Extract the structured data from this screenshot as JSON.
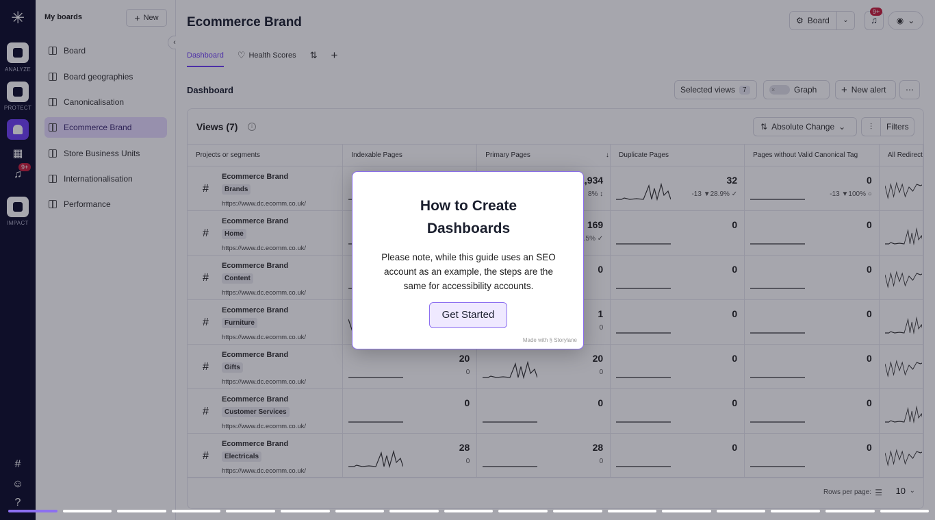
{
  "rail": {
    "sections": [
      "ANALYZE",
      "PROTECT",
      "IMPACT"
    ],
    "notif_badge": "9+"
  },
  "sidebar": {
    "title": "My boards",
    "new_label": "New",
    "items": [
      {
        "label": "Board"
      },
      {
        "label": "Board geographies"
      },
      {
        "label": "Canonicalisation"
      },
      {
        "label": "Ecommerce Brand"
      },
      {
        "label": "Store Business Units"
      },
      {
        "label": "Internationalisation"
      },
      {
        "label": "Performance"
      }
    ]
  },
  "header": {
    "title": "Ecommerce Brand",
    "board_label": "Board",
    "bell_badge": "9+"
  },
  "tabs": [
    {
      "label": "Dashboard"
    },
    {
      "label": "Health Scores"
    }
  ],
  "toolbar": {
    "title": "Dashboard",
    "selected_views": "Selected views",
    "selected_count": "7",
    "graph": "Graph",
    "new_alert": "New alert"
  },
  "views": {
    "title": "Views (7)",
    "sort_label": "Absolute Change",
    "filters_label": "Filters"
  },
  "table": {
    "columns": [
      "Projects or segments",
      "Indexable Pages",
      "Primary Pages",
      "Duplicate Pages",
      "Pages without Valid Canonical Tag",
      "All Redirect"
    ],
    "rows": [
      {
        "name": "Ecommerce Brand",
        "tag": "Brands",
        "url": "https://www.dc.ecomm.co.uk/",
        "indexable": "",
        "primary": "1,934",
        "primary_delta": "8% ↕",
        "duplicate": "32",
        "duplicate_delta": "-13 ▼28.9% ✓",
        "canonical": "0",
        "canonical_delta": "-13 ▼100% ○"
      },
      {
        "name": "Ecommerce Brand",
        "tag": "Home",
        "url": "https://www.dc.ecomm.co.uk/",
        "indexable": "",
        "primary": "169",
        "primary_delta": ".5% ✓",
        "duplicate": "0",
        "duplicate_delta": "",
        "canonical": "0",
        "canonical_delta": ""
      },
      {
        "name": "Ecommerce Brand",
        "tag": "Content",
        "url": "https://www.dc.ecomm.co.uk/",
        "indexable": "",
        "primary": "0",
        "primary_delta": "",
        "duplicate": "0",
        "duplicate_delta": "",
        "canonical": "0",
        "canonical_delta": ""
      },
      {
        "name": "Ecommerce Brand",
        "tag": "Furniture",
        "url": "https://www.dc.ecomm.co.uk/",
        "indexable": "",
        "primary": "1",
        "primary_delta": "0",
        "duplicate": "0",
        "duplicate_delta": "",
        "canonical": "0",
        "canonical_delta": ""
      },
      {
        "name": "Ecommerce Brand",
        "tag": "Gifts",
        "url": "https://www.dc.ecomm.co.uk/",
        "indexable": "20",
        "indexable_delta": "0",
        "primary": "20",
        "primary_delta": "0",
        "duplicate": "0",
        "duplicate_delta": "",
        "canonical": "0",
        "canonical_delta": ""
      },
      {
        "name": "Ecommerce Brand",
        "tag": "Customer Services",
        "url": "https://www.dc.ecomm.co.uk/",
        "indexable": "0",
        "indexable_delta": "",
        "primary": "0",
        "primary_delta": "",
        "duplicate": "0",
        "duplicate_delta": "",
        "canonical": "0",
        "canonical_delta": ""
      },
      {
        "name": "Ecommerce Brand",
        "tag": "Electricals",
        "url": "https://www.dc.ecomm.co.uk/",
        "indexable": "28",
        "indexable_delta": "0",
        "primary": "28",
        "primary_delta": "0",
        "duplicate": "0",
        "duplicate_delta": "",
        "canonical": "0",
        "canonical_delta": ""
      }
    ]
  },
  "footer": {
    "rows_per_page": "Rows per page:",
    "value": "10"
  },
  "modal": {
    "title": "How to Create Dashboards",
    "body": "Please note, while this guide uses an SEO account as an example, the steps are the same for accessibility accounts.",
    "button": "Get Started",
    "made_with": "Made with § Storylane"
  },
  "progress": {
    "current": 1,
    "total": 17
  },
  "colors": {
    "accent": "#6f3ff5",
    "rail": "#0c0c2a",
    "badge": "#c81e3c"
  }
}
